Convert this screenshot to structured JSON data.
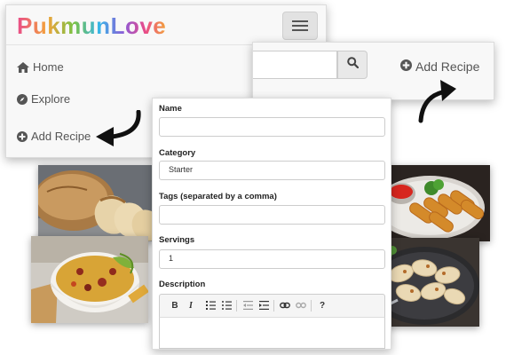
{
  "brand": {
    "name": "PukmunLove"
  },
  "nav": {
    "items": [
      {
        "label": "Home",
        "icon": "home-icon"
      },
      {
        "label": "Explore",
        "icon": "compass-icon"
      },
      {
        "label": "Add Recipe",
        "icon": "plus-circle-icon"
      }
    ]
  },
  "search_bar": {
    "placeholder": "",
    "add_recipe_label": "Add Recipe"
  },
  "form": {
    "name_label": "Name",
    "name_value": "",
    "category_label": "Category",
    "category_value": "Starter",
    "tags_label": "Tags (separated by a comma)",
    "tags_value": "",
    "servings_label": "Servings",
    "servings_value": "1",
    "description_label": "Description",
    "toolbar": {
      "bold": "B",
      "italic": "I",
      "help": "?"
    }
  },
  "colors": {
    "accent_pink": "#e94b8a",
    "accent_orange": "#f3a33b",
    "accent_green": "#7ac143",
    "accent_blue": "#38b6e8",
    "nav_text": "#555555",
    "arrow": "#111111"
  }
}
